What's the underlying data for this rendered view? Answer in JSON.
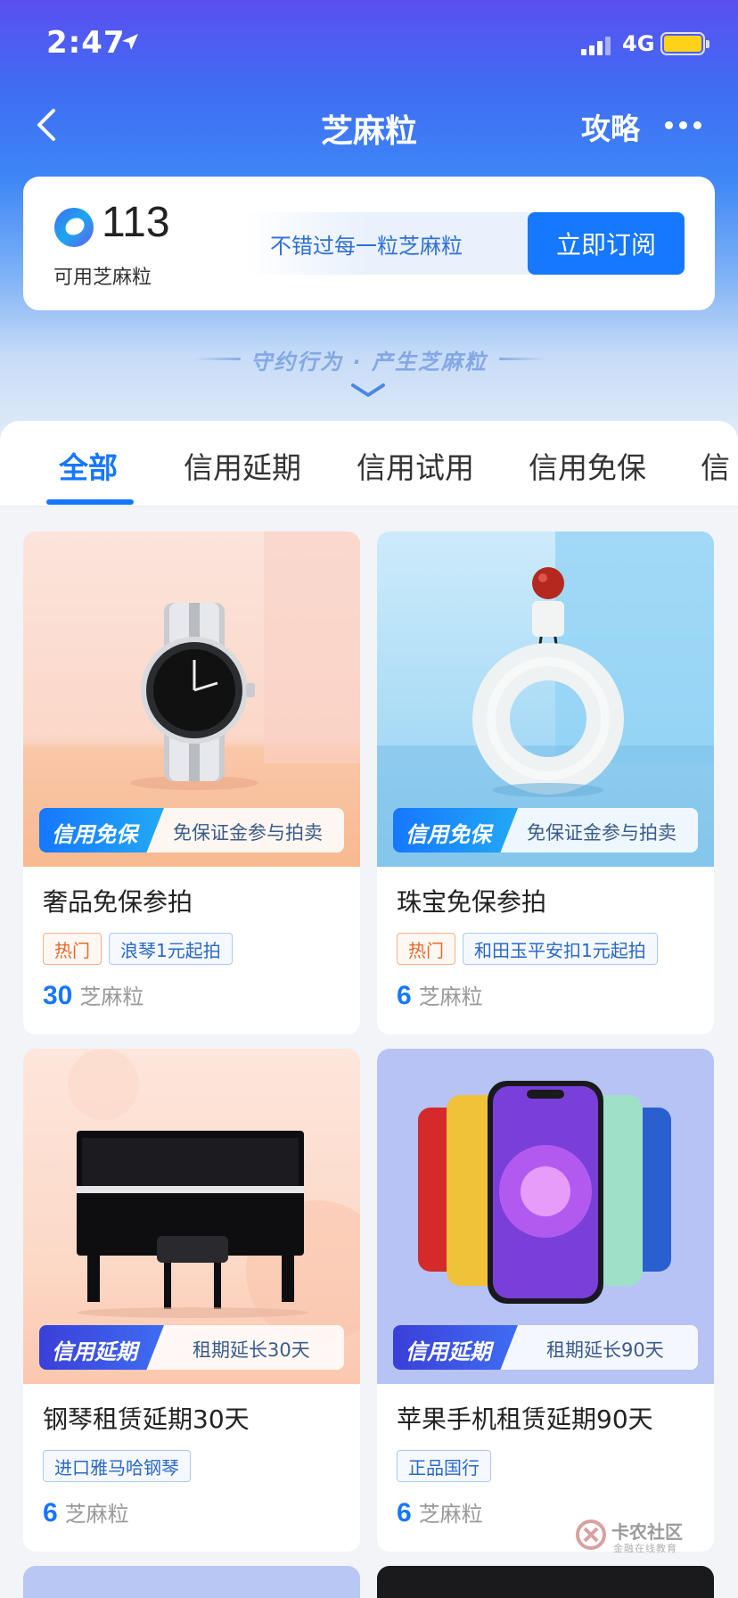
{
  "status_bar": {
    "time": "2:47",
    "network": "4G"
  },
  "nav": {
    "title": "芝麻粒",
    "guide": "攻略"
  },
  "points": {
    "value": "113",
    "label": "可用芝麻粒",
    "promo": "不错过每一粒芝麻粒",
    "subscribe": "立即订阅"
  },
  "slogan": "守约行为 · 产生芝麻粒",
  "tabs": [
    "全部",
    "信用延期",
    "信用试用",
    "信用免保",
    "信"
  ],
  "cards": [
    {
      "badge": "信用免保",
      "tag_desc": "免保证金参与拍卖",
      "title": "奢品免保参拍",
      "labels": [
        "热门",
        "浪琴1元起拍"
      ],
      "price": "30",
      "unit": "芝麻粒"
    },
    {
      "badge": "信用免保",
      "tag_desc": "免保证金参与拍卖",
      "title": "珠宝免保参拍",
      "labels": [
        "热门",
        "和田玉平安扣1元起拍"
      ],
      "price": "6",
      "unit": "芝麻粒"
    },
    {
      "badge": "信用延期",
      "tag_desc": "租期延长30天",
      "title": "钢琴租赁延期30天",
      "labels": [
        "进口雅马哈钢琴"
      ],
      "price": "6",
      "unit": "芝麻粒"
    },
    {
      "badge": "信用延期",
      "tag_desc": "租期延长90天",
      "title": "苹果手机租赁延期90天",
      "labels": [
        "正品国行"
      ],
      "price": "6",
      "unit": "芝麻粒"
    }
  ],
  "watermark": {
    "name": "卡农社区",
    "sub": "金融在线教育"
  },
  "colors": {
    "accent": "#1677ff",
    "hot": "#e66a2c"
  },
  "icons": [
    "location-arrow-icon",
    "signal-icon",
    "battery-icon",
    "back-icon",
    "more-icon",
    "sesame-icon",
    "chevron-down-icon"
  ]
}
